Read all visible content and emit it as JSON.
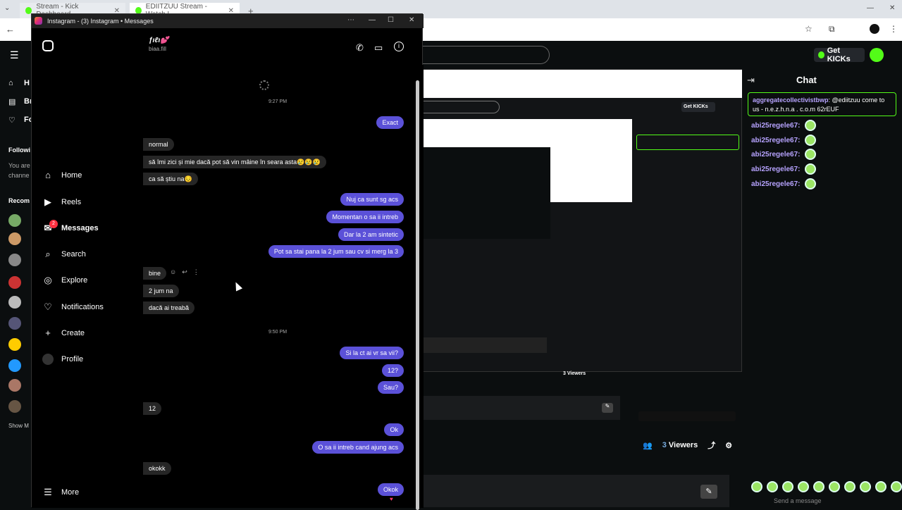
{
  "browser": {
    "tabs": [
      {
        "label": "Stream - Kick Dashboard"
      },
      {
        "label": "EDIITZUU Stream - Watch L"
      }
    ],
    "new_tab": "+"
  },
  "kick": {
    "get_kicks": "Get KICKs",
    "chat_title": "Chat",
    "pinned": {
      "user": "aggregatecollectivistbwp",
      "text": ": @ediitzuu come to us - n.e.z.h.n.a . c.o.m 62rEUF"
    },
    "chat_lines": [
      {
        "user": "abi25regele67:"
      },
      {
        "user": "abi25regele67:"
      },
      {
        "user": "abi25regele67:"
      },
      {
        "user": "abi25regele67:"
      },
      {
        "user": "abi25regele67:"
      }
    ],
    "viewers_count": "3",
    "viewers_label": "Viewers",
    "send_placeholder": "Send a message",
    "sidebar_letters": [
      "H",
      "Br",
      "Fo"
    ],
    "following_label": "Followi",
    "following_text": [
      "You are",
      "channe"
    ],
    "recommended_label": "Recom",
    "show_more": "Show M"
  },
  "ig": {
    "window_title": "Instagram - (3) Instagram • Messages",
    "nav": [
      {
        "label": "Home",
        "icon": "home-icon"
      },
      {
        "label": "Reels",
        "icon": "reels-icon"
      },
      {
        "label": "Messages",
        "icon": "messenger-icon"
      },
      {
        "label": "Search",
        "icon": "search-icon"
      },
      {
        "label": "Explore",
        "icon": "compass-icon"
      },
      {
        "label": "Notifications",
        "icon": "heart-icon"
      },
      {
        "label": "Create",
        "icon": "plus-icon"
      },
      {
        "label": "Profile",
        "icon": "avatar"
      }
    ],
    "messages_badge": "2",
    "more": "More",
    "contact_name": "ƒιℓι💕",
    "contact_handle": "biaa.fill",
    "timestamps": [
      "9:27 PM",
      "9:50 PM"
    ],
    "messages": [
      {
        "text": "Exact",
        "dir": "out"
      },
      {
        "text": "normal",
        "dir": "in"
      },
      {
        "text": "să îmi zici și mie dacă pot să vin mâine în seara asta😢😢😢",
        "dir": "in"
      },
      {
        "text": "ca să știu na😔",
        "dir": "in"
      },
      {
        "text": "Nuj ca sunt sg acs",
        "dir": "out"
      },
      {
        "text": "Momentan o sa ii intreb",
        "dir": "out"
      },
      {
        "text": "Dar la 2 am sintetic",
        "dir": "out"
      },
      {
        "text": "Pot sa stai pana la 2 jum sau cv si merg la 3",
        "dir": "out"
      },
      {
        "text": "bine",
        "dir": "in"
      },
      {
        "text": "2 jum na",
        "dir": "in"
      },
      {
        "text": "dacă ai treabă",
        "dir": "in"
      },
      {
        "text": "Si la ct ai vr sa vii?",
        "dir": "out"
      },
      {
        "text": "12?",
        "dir": "out"
      },
      {
        "text": "Sau?",
        "dir": "out"
      },
      {
        "text": "12",
        "dir": "in"
      },
      {
        "text": "Ok",
        "dir": "out"
      },
      {
        "text": "O sa ii intreb cand ajung acs",
        "dir": "out"
      },
      {
        "text": "okokk",
        "dir": "in"
      },
      {
        "text": "Okok",
        "dir": "out"
      }
    ]
  }
}
